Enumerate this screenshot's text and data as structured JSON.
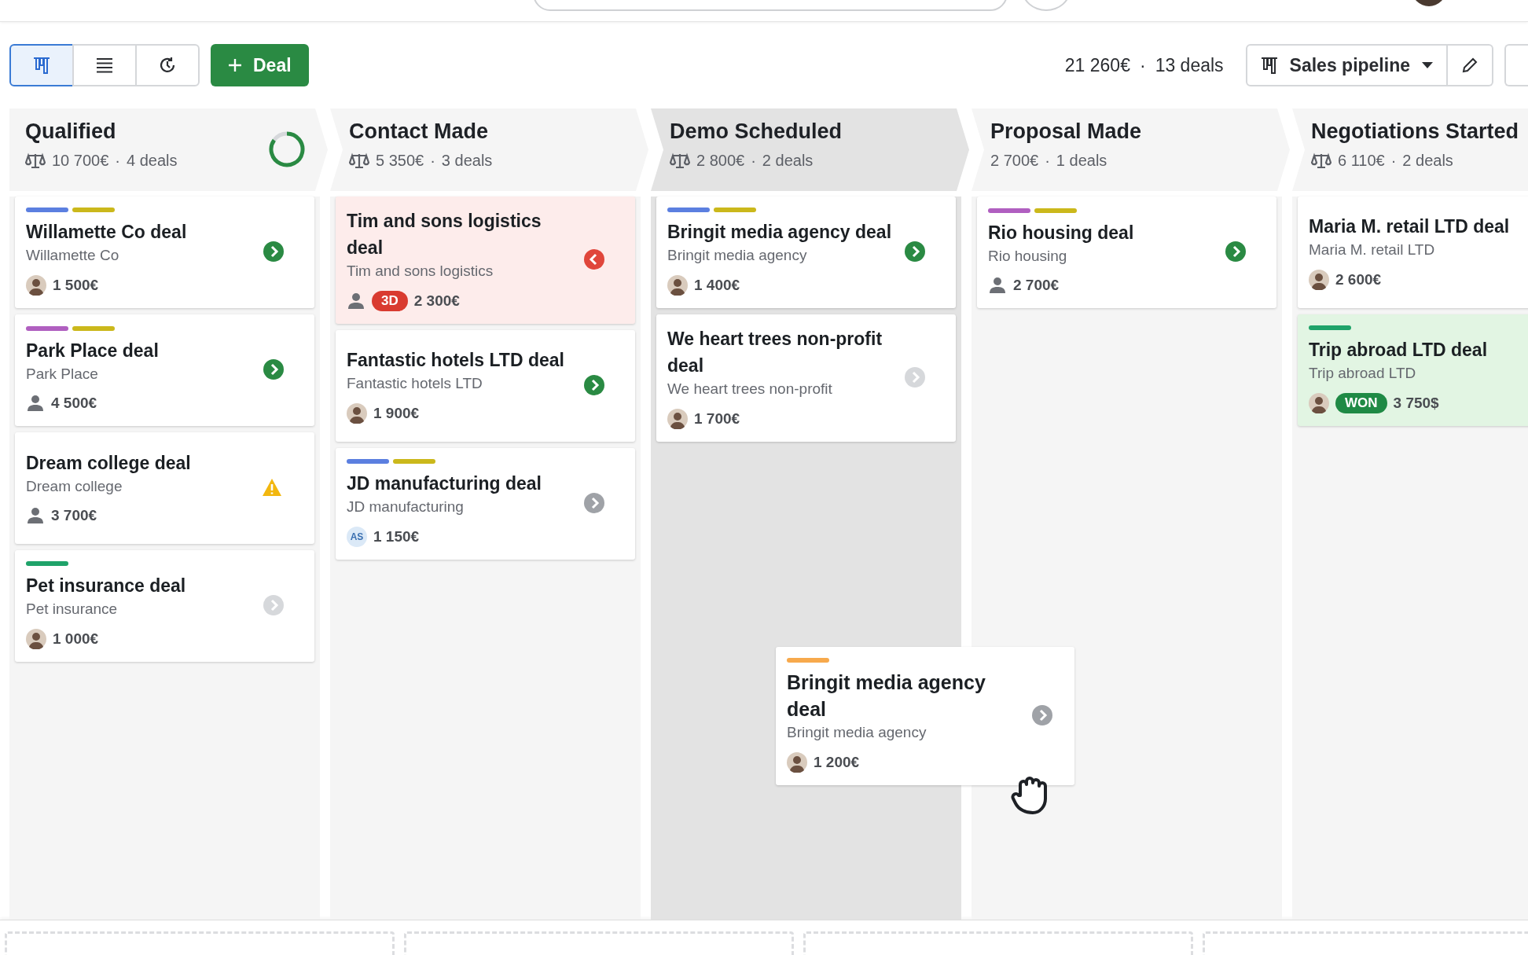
{
  "toolbar": {
    "views": [
      {
        "kind": "pipeline",
        "selected": true
      },
      {
        "kind": "list",
        "selected": false
      },
      {
        "kind": "forecast",
        "selected": false
      }
    ],
    "add_button": {
      "label": "Deal"
    },
    "summary": {
      "total": "21 260€",
      "separator": "·",
      "count": "13 deals"
    },
    "pipeline_select": {
      "label": "Sales pipeline"
    }
  },
  "columns": [
    {
      "title": "Qualified",
      "weight_icon": true,
      "total": "10 700€",
      "separator": "·",
      "count": "4 deals",
      "highlighted": false,
      "ring": {
        "level": 0.85
      },
      "cards": [
        {
          "tags": [
            {
              "color": "#5b7fe0"
            },
            {
              "color": "#cbb81b"
            }
          ],
          "title": "Willamette Co deal",
          "org": "Willamette Co",
          "owner": {
            "kind": "photo"
          },
          "value": "1 500€",
          "status_icon": {
            "kind": "arrow",
            "color": "#2a8a43"
          },
          "rotting": false,
          "won": false
        },
        {
          "tags": [
            {
              "color": "#b05fc0"
            },
            {
              "color": "#cbb81b"
            }
          ],
          "title": "Park Place deal",
          "org": "Park Place",
          "owner": {
            "kind": "person"
          },
          "value": "4 500€",
          "status_icon": {
            "kind": "arrow",
            "color": "#2a8a43"
          },
          "rotting": false,
          "won": false
        },
        {
          "title": "Dream college deal",
          "org": "Dream college",
          "owner": {
            "kind": "person"
          },
          "value": "3 700€",
          "status_icon": {
            "kind": "warning",
            "color": "#f2b70f"
          },
          "rotting": false,
          "won": false
        },
        {
          "tags": [
            {
              "color": "#1fa36a"
            }
          ],
          "title": "Pet insurance deal",
          "org": "Pet insurance",
          "owner": {
            "kind": "photo"
          },
          "value": "1 000€",
          "status_icon": {
            "kind": "arrow",
            "color": "#d6d8db"
          },
          "rotting": false,
          "won": false
        }
      ]
    },
    {
      "title": "Contact Made",
      "weight_icon": true,
      "total": "5 350€",
      "separator": "·",
      "count": "3 deals",
      "highlighted": false,
      "cards": [
        {
          "title": "Tim and sons logistics deal",
          "org": "Tim and sons logistics",
          "owner": {
            "kind": "person"
          },
          "badge": {
            "text": "3D",
            "kind": "overdue"
          },
          "value": "2 300€",
          "status_icon": {
            "kind": "back_arrow",
            "color": "#e0463b"
          },
          "rotting": true,
          "won": false
        },
        {
          "title": "Fantastic hotels LTD deal",
          "org": "Fantastic hotels LTD",
          "owner": {
            "kind": "photo"
          },
          "value": "1 900€",
          "status_icon": {
            "kind": "arrow",
            "color": "#2a8a43"
          },
          "rotting": false,
          "won": false
        },
        {
          "tags": [
            {
              "color": "#5b7fe0"
            },
            {
              "color": "#cbb81b"
            }
          ],
          "title": "JD manufacturing deal",
          "org": "JD manufacturing",
          "owner": {
            "kind": "initials",
            "text": "AS"
          },
          "value": "1 150€",
          "status_icon": {
            "kind": "arrow",
            "color": "#9fa2a7"
          },
          "rotting": false,
          "won": false
        }
      ]
    },
    {
      "title": "Demo Scheduled",
      "weight_icon": true,
      "total": "2 800€",
      "separator": "·",
      "count": "2 deals",
      "highlighted": true,
      "cards": [
        {
          "tags": [
            {
              "color": "#5b7fe0"
            },
            {
              "color": "#cbb81b"
            }
          ],
          "title": "Bringit media agency deal",
          "org": "Bringit media agency",
          "owner": {
            "kind": "photo"
          },
          "value": "1 400€",
          "status_icon": {
            "kind": "arrow",
            "color": "#2a8a43"
          },
          "rotting": false,
          "won": false
        },
        {
          "title": "We heart trees non-profit deal",
          "org": "We heart trees non-profit",
          "owner": {
            "kind": "photo"
          },
          "value": "1 700€",
          "status_icon": {
            "kind": "arrow",
            "color": "#d6d8db"
          },
          "rotting": false,
          "won": false
        }
      ]
    },
    {
      "title": "Proposal Made",
      "weight_icon": false,
      "total": "2 700€",
      "separator": "·",
      "count": "1 deals",
      "highlighted": false,
      "cards": [
        {
          "tags": [
            {
              "color": "#b05fc0"
            },
            {
              "color": "#cbb81b"
            }
          ],
          "title": "Rio housing deal",
          "org": "Rio housing",
          "owner": {
            "kind": "person"
          },
          "value": "2 700€",
          "status_icon": {
            "kind": "arrow",
            "color": "#2a8a43"
          },
          "rotting": false,
          "won": false
        }
      ]
    },
    {
      "title": "Negotiations Started",
      "weight_icon": true,
      "total": "6 110€",
      "separator": "·",
      "count": "2 deals",
      "highlighted": false,
      "cards": [
        {
          "title": "Maria M. retail LTD deal",
          "org": "Maria M. retail LTD",
          "owner": {
            "kind": "photo"
          },
          "value": "2 600€",
          "rotting": false,
          "won": false
        },
        {
          "tags": [
            {
              "color": "#1fa36a"
            }
          ],
          "title": "Trip abroad LTD deal",
          "org": "Trip abroad LTD",
          "owner": {
            "kind": "photo"
          },
          "badge": {
            "text": "WON",
            "kind": "won"
          },
          "value": "3 750$",
          "rotting": false,
          "won": true
        }
      ]
    }
  ],
  "dragged_card": {
    "tags": [
      {
        "color": "#f7a94c"
      }
    ],
    "title": "Bringit media agency deal",
    "org": "Bringit media agency",
    "owner": {
      "kind": "photo"
    },
    "value": "1 200€",
    "status_icon": {
      "kind": "arrow",
      "color": "#9fa2a7"
    },
    "rotting": false,
    "won": false
  }
}
